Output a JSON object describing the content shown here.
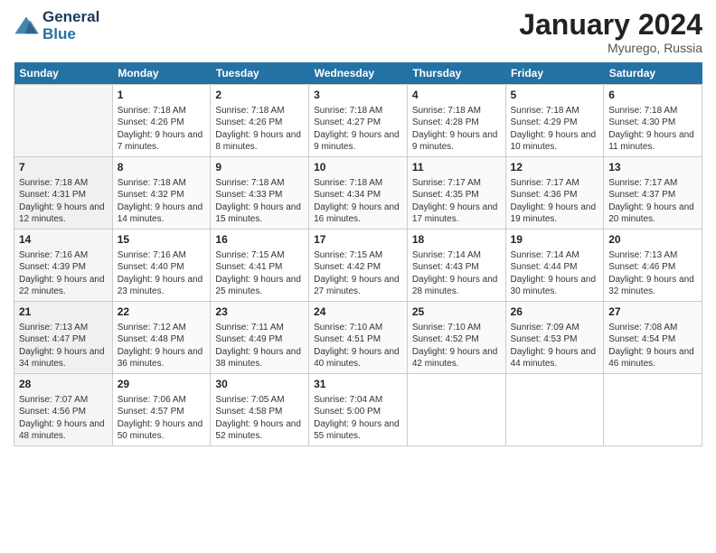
{
  "header": {
    "logo_line1": "General",
    "logo_line2": "Blue",
    "month_title": "January 2024",
    "location": "Myurego, Russia"
  },
  "weekdays": [
    "Sunday",
    "Monday",
    "Tuesday",
    "Wednesday",
    "Thursday",
    "Friday",
    "Saturday"
  ],
  "weeks": [
    [
      {
        "day": "",
        "sunrise": "",
        "sunset": "",
        "daylight": ""
      },
      {
        "day": "1",
        "sunrise": "Sunrise: 7:18 AM",
        "sunset": "Sunset: 4:26 PM",
        "daylight": "Daylight: 9 hours and 7 minutes."
      },
      {
        "day": "2",
        "sunrise": "Sunrise: 7:18 AM",
        "sunset": "Sunset: 4:26 PM",
        "daylight": "Daylight: 9 hours and 8 minutes."
      },
      {
        "day": "3",
        "sunrise": "Sunrise: 7:18 AM",
        "sunset": "Sunset: 4:27 PM",
        "daylight": "Daylight: 9 hours and 9 minutes."
      },
      {
        "day": "4",
        "sunrise": "Sunrise: 7:18 AM",
        "sunset": "Sunset: 4:28 PM",
        "daylight": "Daylight: 9 hours and 9 minutes."
      },
      {
        "day": "5",
        "sunrise": "Sunrise: 7:18 AM",
        "sunset": "Sunset: 4:29 PM",
        "daylight": "Daylight: 9 hours and 10 minutes."
      },
      {
        "day": "6",
        "sunrise": "Sunrise: 7:18 AM",
        "sunset": "Sunset: 4:30 PM",
        "daylight": "Daylight: 9 hours and 11 minutes."
      }
    ],
    [
      {
        "day": "7",
        "sunrise": "Sunrise: 7:18 AM",
        "sunset": "Sunset: 4:31 PM",
        "daylight": "Daylight: 9 hours and 12 minutes."
      },
      {
        "day": "8",
        "sunrise": "Sunrise: 7:18 AM",
        "sunset": "Sunset: 4:32 PM",
        "daylight": "Daylight: 9 hours and 14 minutes."
      },
      {
        "day": "9",
        "sunrise": "Sunrise: 7:18 AM",
        "sunset": "Sunset: 4:33 PM",
        "daylight": "Daylight: 9 hours and 15 minutes."
      },
      {
        "day": "10",
        "sunrise": "Sunrise: 7:18 AM",
        "sunset": "Sunset: 4:34 PM",
        "daylight": "Daylight: 9 hours and 16 minutes."
      },
      {
        "day": "11",
        "sunrise": "Sunrise: 7:17 AM",
        "sunset": "Sunset: 4:35 PM",
        "daylight": "Daylight: 9 hours and 17 minutes."
      },
      {
        "day": "12",
        "sunrise": "Sunrise: 7:17 AM",
        "sunset": "Sunset: 4:36 PM",
        "daylight": "Daylight: 9 hours and 19 minutes."
      },
      {
        "day": "13",
        "sunrise": "Sunrise: 7:17 AM",
        "sunset": "Sunset: 4:37 PM",
        "daylight": "Daylight: 9 hours and 20 minutes."
      }
    ],
    [
      {
        "day": "14",
        "sunrise": "Sunrise: 7:16 AM",
        "sunset": "Sunset: 4:39 PM",
        "daylight": "Daylight: 9 hours and 22 minutes."
      },
      {
        "day": "15",
        "sunrise": "Sunrise: 7:16 AM",
        "sunset": "Sunset: 4:40 PM",
        "daylight": "Daylight: 9 hours and 23 minutes."
      },
      {
        "day": "16",
        "sunrise": "Sunrise: 7:15 AM",
        "sunset": "Sunset: 4:41 PM",
        "daylight": "Daylight: 9 hours and 25 minutes."
      },
      {
        "day": "17",
        "sunrise": "Sunrise: 7:15 AM",
        "sunset": "Sunset: 4:42 PM",
        "daylight": "Daylight: 9 hours and 27 minutes."
      },
      {
        "day": "18",
        "sunrise": "Sunrise: 7:14 AM",
        "sunset": "Sunset: 4:43 PM",
        "daylight": "Daylight: 9 hours and 28 minutes."
      },
      {
        "day": "19",
        "sunrise": "Sunrise: 7:14 AM",
        "sunset": "Sunset: 4:44 PM",
        "daylight": "Daylight: 9 hours and 30 minutes."
      },
      {
        "day": "20",
        "sunrise": "Sunrise: 7:13 AM",
        "sunset": "Sunset: 4:46 PM",
        "daylight": "Daylight: 9 hours and 32 minutes."
      }
    ],
    [
      {
        "day": "21",
        "sunrise": "Sunrise: 7:13 AM",
        "sunset": "Sunset: 4:47 PM",
        "daylight": "Daylight: 9 hours and 34 minutes."
      },
      {
        "day": "22",
        "sunrise": "Sunrise: 7:12 AM",
        "sunset": "Sunset: 4:48 PM",
        "daylight": "Daylight: 9 hours and 36 minutes."
      },
      {
        "day": "23",
        "sunrise": "Sunrise: 7:11 AM",
        "sunset": "Sunset: 4:49 PM",
        "daylight": "Daylight: 9 hours and 38 minutes."
      },
      {
        "day": "24",
        "sunrise": "Sunrise: 7:10 AM",
        "sunset": "Sunset: 4:51 PM",
        "daylight": "Daylight: 9 hours and 40 minutes."
      },
      {
        "day": "25",
        "sunrise": "Sunrise: 7:10 AM",
        "sunset": "Sunset: 4:52 PM",
        "daylight": "Daylight: 9 hours and 42 minutes."
      },
      {
        "day": "26",
        "sunrise": "Sunrise: 7:09 AM",
        "sunset": "Sunset: 4:53 PM",
        "daylight": "Daylight: 9 hours and 44 minutes."
      },
      {
        "day": "27",
        "sunrise": "Sunrise: 7:08 AM",
        "sunset": "Sunset: 4:54 PM",
        "daylight": "Daylight: 9 hours and 46 minutes."
      }
    ],
    [
      {
        "day": "28",
        "sunrise": "Sunrise: 7:07 AM",
        "sunset": "Sunset: 4:56 PM",
        "daylight": "Daylight: 9 hours and 48 minutes."
      },
      {
        "day": "29",
        "sunrise": "Sunrise: 7:06 AM",
        "sunset": "Sunset: 4:57 PM",
        "daylight": "Daylight: 9 hours and 50 minutes."
      },
      {
        "day": "30",
        "sunrise": "Sunrise: 7:05 AM",
        "sunset": "Sunset: 4:58 PM",
        "daylight": "Daylight: 9 hours and 52 minutes."
      },
      {
        "day": "31",
        "sunrise": "Sunrise: 7:04 AM",
        "sunset": "Sunset: 5:00 PM",
        "daylight": "Daylight: 9 hours and 55 minutes."
      },
      {
        "day": "",
        "sunrise": "",
        "sunset": "",
        "daylight": ""
      },
      {
        "day": "",
        "sunrise": "",
        "sunset": "",
        "daylight": ""
      },
      {
        "day": "",
        "sunrise": "",
        "sunset": "",
        "daylight": ""
      }
    ]
  ]
}
